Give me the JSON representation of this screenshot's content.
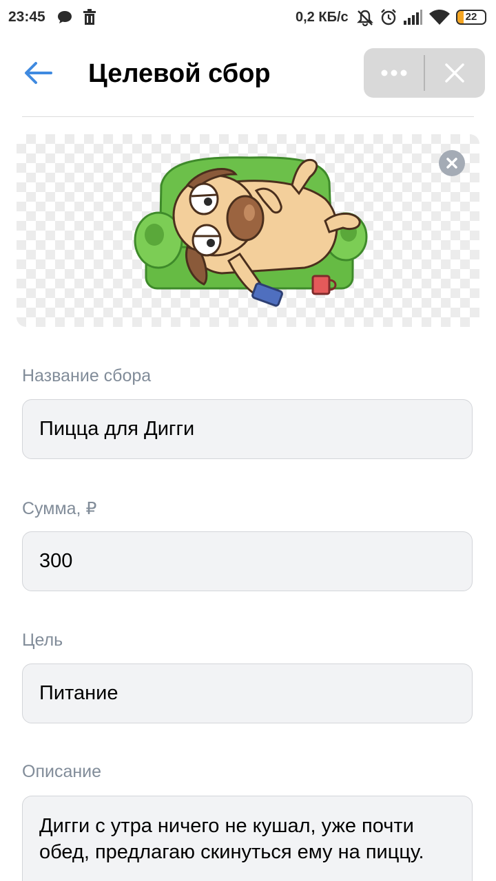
{
  "status_bar": {
    "time": "23:45",
    "speed": "0,2 КБ/с",
    "battery": "22",
    "icons": [
      "chat-icon",
      "trash-icon",
      "mute-icon",
      "alarm-icon",
      "signal-icon",
      "wifi-icon",
      "battery-icon"
    ]
  },
  "header": {
    "title": "Целевой сбор",
    "back_icon": "arrow-left-icon",
    "more_icon": "ellipsis-icon",
    "close_icon": "close-icon"
  },
  "image": {
    "remove_icon": "close-circle-icon",
    "sticker": "dog-on-couch"
  },
  "form": {
    "name_label": "Название сбора",
    "name_value": "Пицца для Дигги",
    "amount_label": "Сумма, ₽",
    "amount_value": "300",
    "goal_label": "Цель",
    "goal_value": "Питание",
    "description_label": "Описание",
    "description_value": "Дигги с утра ничего не кушал, уже почти обед, предлагаю скинуться ему на пиццу."
  },
  "colors": {
    "accent": "#3f8ae0",
    "label": "#818c99",
    "field_bg": "#f2f3f5",
    "capsule_bg": "#d9d9d9"
  }
}
